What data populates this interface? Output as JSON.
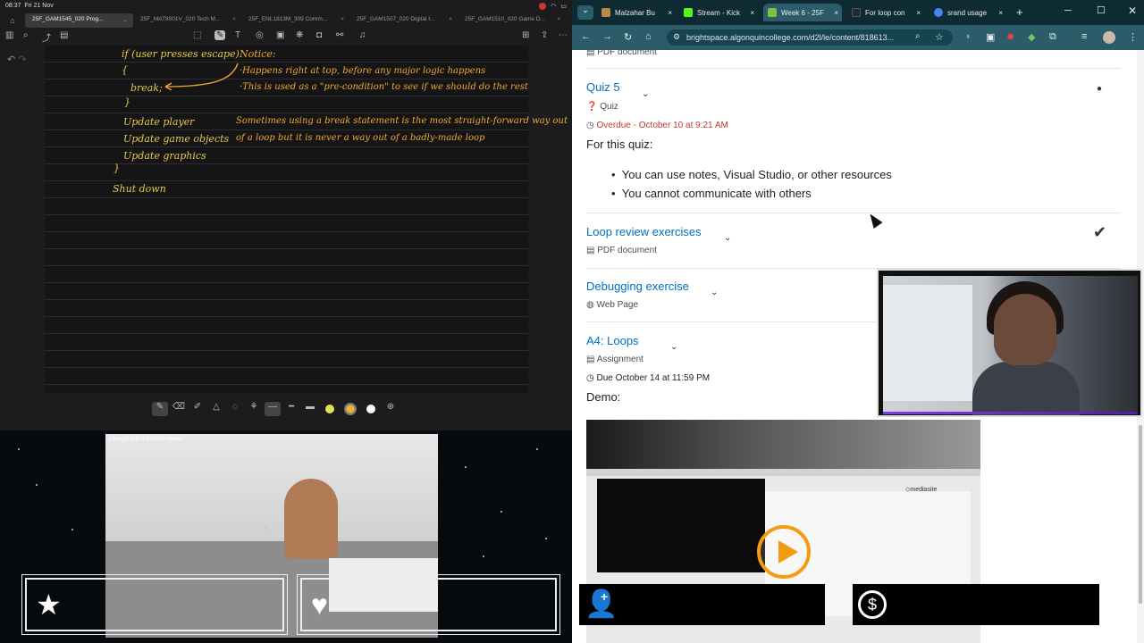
{
  "status": {
    "time": "08:37",
    "date": "Fri 21 Nov"
  },
  "notes": {
    "tabs": [
      "25F_GAM1545_020 Prog...",
      "25F_MAT8001V_020 Tech M...",
      "25F_ENL1813M_309 Comm...",
      "25F_GAM1507_020 Digital I...",
      "25F_GAM1510_020 Game D..."
    ],
    "lines": {
      "l1": "if (user presses escape)",
      "l2": "{",
      "l3": "break;",
      "l4": "}",
      "l5": "Update player",
      "l6": "Update game objects",
      "l7": "Update graphics",
      "l8": "}",
      "l9": "Shut down",
      "n1": "Notice:",
      "n2": "·Happens right at top, before any major logic happens",
      "n3": "·This is used as a \"pre-condition\" to see if we should do the rest",
      "n4": "Sometimes using a break statement is the most straight-forward way out",
      "n5": "of a loop but it is never a way out of a badly-made loop"
    },
    "pen_colors": [
      "#e5e05a",
      "#e8b23a",
      "#ffffff"
    ]
  },
  "video": {
    "title": "I Bought A $10,000,000 House!"
  },
  "browser": {
    "tabs": [
      {
        "label": "Malzahar Bu",
        "color": "#b88a44"
      },
      {
        "label": "Stream - Kick",
        "color": "#53fc18"
      },
      {
        "label": "Week 6 - 25F",
        "color": "#7cc242"
      },
      {
        "label": "For loop con",
        "color": "#1e2b3a"
      },
      {
        "label": "srand usage",
        "color": "#4285f4"
      }
    ],
    "url": "brightspace.algonquincollege.com/d2l/le/content/818613...",
    "content": {
      "prev_type": "PDF document",
      "quiz": {
        "title": "Quiz 5",
        "type": "Quiz",
        "due": "Overdue - October 10 at 9:21 AM",
        "intro": "For this quiz:",
        "bullets": [
          "You can use notes, Visual Studio, or other resources",
          "You cannot communicate with others"
        ]
      },
      "loop": {
        "title": "Loop review exercises",
        "type": "PDF document"
      },
      "debug": {
        "title": "Debugging exercise",
        "type": "Web Page"
      },
      "a4": {
        "title": "A4: Loops",
        "type": "Assignment",
        "due": "Due October 14 at 11:59 PM",
        "demo": "Demo:"
      },
      "mediasite": "◇mediasite"
    }
  }
}
